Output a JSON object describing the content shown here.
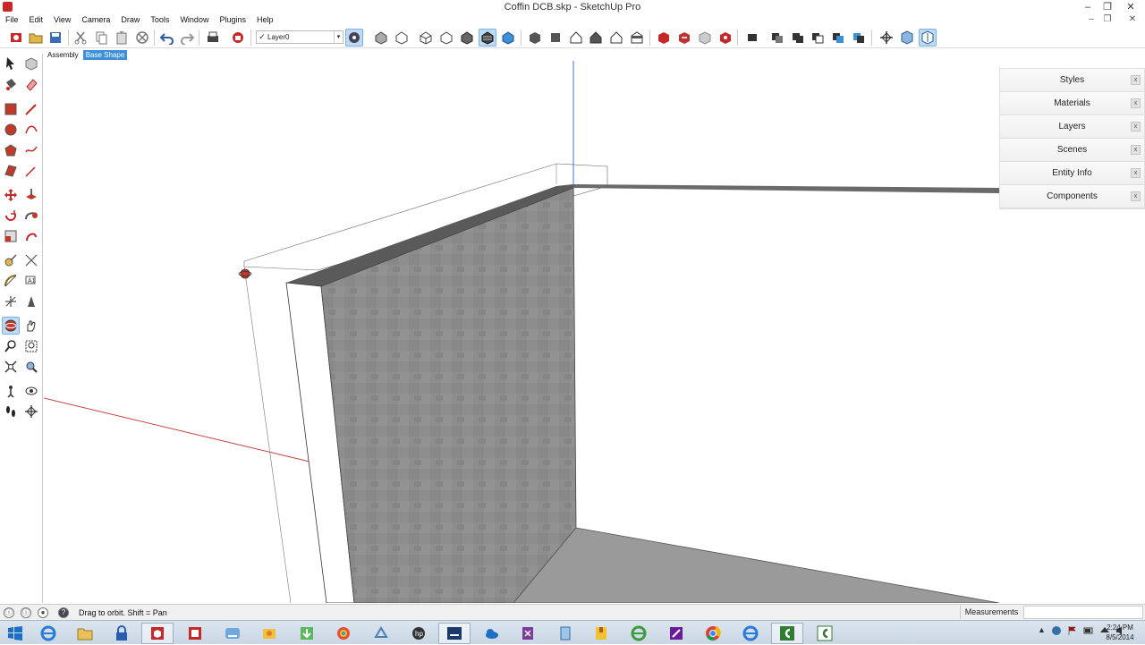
{
  "window": {
    "title": "Coffin DCB.skp - SketchUp Pro",
    "min": "–",
    "max": "❐",
    "close": "✕"
  },
  "menus": [
    "File",
    "Edit",
    "View",
    "Camera",
    "Draw",
    "Tools",
    "Window",
    "Plugins",
    "Help"
  ],
  "document_controls": {
    "min": "–",
    "restore": "❐",
    "close": "✕"
  },
  "toolbar": {
    "layer_value": "Layer0",
    "layer_check": "✓",
    "dropdown_arrow": "▾"
  },
  "breadcrumb": [
    {
      "label": "Assembly",
      "active": false
    },
    {
      "label": "Base Shape",
      "active": true
    }
  ],
  "tray": {
    "items": [
      "Styles",
      "Materials",
      "Layers",
      "Scenes",
      "Entity Info",
      "Components"
    ],
    "close_glyph": "x"
  },
  "status": {
    "hint": "Drag to orbit.  Shift = Pan",
    "measurements_label": "Measurements",
    "measurements_value": "",
    "icon_glyphs": [
      "ⓘ",
      "ⓘ",
      "●",
      "?"
    ]
  },
  "taskbar": {
    "clock_time": "2:24 PM",
    "clock_date": "8/5/2014",
    "tray_up": "▲"
  },
  "colors": {
    "accent": "#3d8fd9",
    "face_gray": "#8d8d8d",
    "edge_dark": "#555555",
    "axis_red": "#c44444",
    "axis_blue": "#4a6fd8",
    "axis_green": "#4caf50"
  }
}
